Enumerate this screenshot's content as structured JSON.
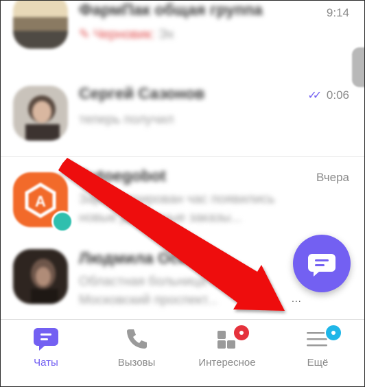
{
  "chats": [
    {
      "name": "ФармПак общая группа",
      "draft_label": "Черновик:",
      "preview": "Эх",
      "time": "9:14",
      "avatar": "group-photo"
    },
    {
      "name": "Сергей Сазонов",
      "preview": "теперь получил",
      "time": "0:06",
      "status": "read-double-check",
      "avatar": "person-photo"
    },
    {
      "name": "Avtoegobot",
      "preview": "Зарегистрирован час появились новые доступные заказы...",
      "time": "Вчера",
      "avatar": "bot-logo"
    },
    {
      "name": "Людмила Осипова",
      "preview": "Областная больница №1 Московский проспект...",
      "time": "",
      "avatar": "person-photo"
    }
  ],
  "ellipsis": "...",
  "tabs": [
    {
      "label": "Чаты",
      "icon": "chat-bubble-icon",
      "active": true
    },
    {
      "label": "Вызовы",
      "icon": "phone-icon",
      "active": false
    },
    {
      "label": "Интересное",
      "icon": "explore-grid-icon",
      "active": false,
      "badge": "dot"
    },
    {
      "label": "Ещё",
      "icon": "menu-icon",
      "active": false,
      "badge": "dot"
    }
  ],
  "colors": {
    "accent": "#7360f2",
    "badge_red": "#e5323c",
    "badge_cyan": "#1fb6e8",
    "draft_red": "#e04a4a",
    "arrow_red": "#ee1111",
    "online_teal": "#2fbfae",
    "bot_orange": "#f26a2a"
  }
}
